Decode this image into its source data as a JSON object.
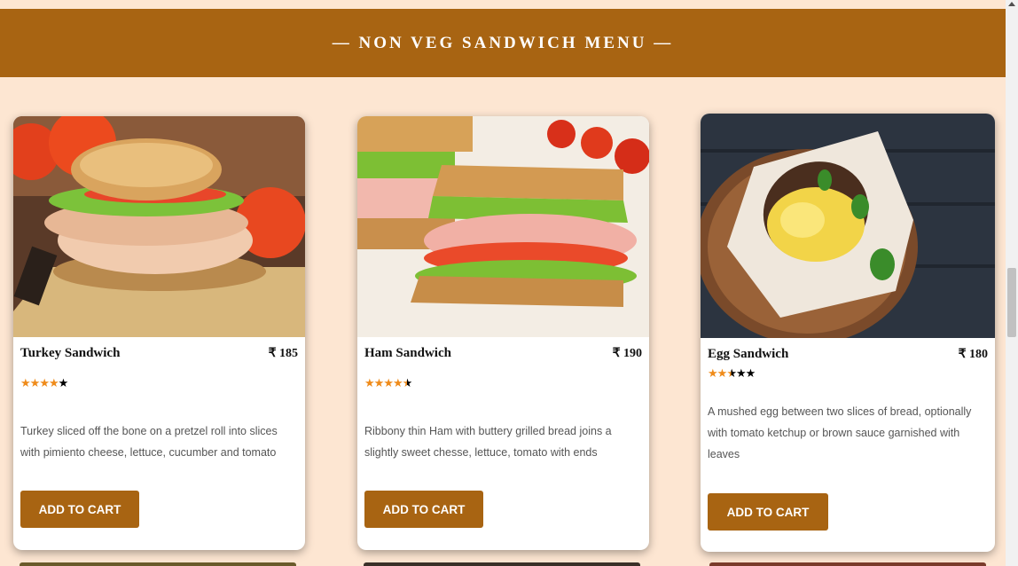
{
  "banner": {
    "title": "— NON VEG SANDWICH MENU —"
  },
  "currency": "₹",
  "cards": [
    {
      "name": "Turkey Sandwich",
      "price": "₹ 185",
      "rating": 4,
      "rating_max": 5,
      "description": "Turkey sliced off the bone on a pretzel roll into slices with pimiento cheese, lettuce, cucumber and tomato",
      "button": "ADD TO CART",
      "image": "turkey-sandwich-photo"
    },
    {
      "name": "Ham Sandwich",
      "price": "₹ 190",
      "rating": 4.5,
      "rating_max": 5,
      "description": "Ribbony thin Ham with buttery grilled bread joins a slightly sweet chesse, lettuce, tomato with ends",
      "button": "ADD TO CART",
      "image": "ham-sandwich-photo"
    },
    {
      "name": "Egg Sandwich",
      "price": "₹ 180",
      "rating": 2.5,
      "rating_max": 5,
      "description": "A mushed egg between two slices of bread, optionally with tomato ketchup or brown sauce garnished with leaves",
      "button": "ADD TO CART",
      "image": "egg-sandwich-photo"
    }
  ],
  "colors": {
    "background": "#fde6d2",
    "accent": "#a86412",
    "star": "#ef8b1a"
  }
}
